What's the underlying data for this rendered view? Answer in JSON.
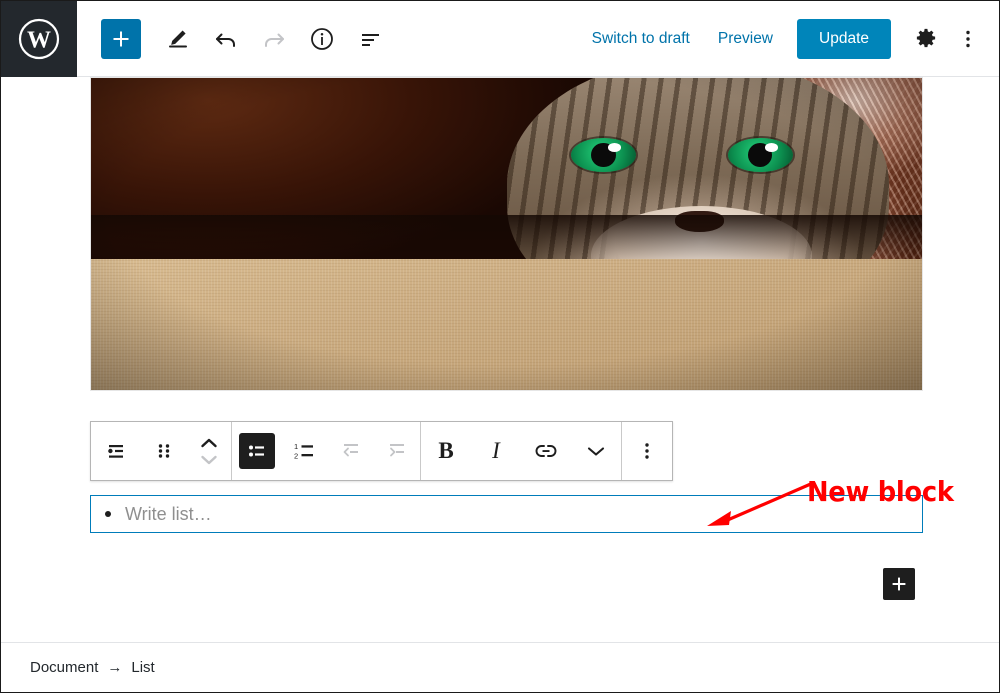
{
  "app": {
    "name": "WordPress Block Editor",
    "logo_icon": "wordpress-logo-icon"
  },
  "topbar": {
    "add_block": {
      "label": "+",
      "icon": "plus-icon",
      "title": "Add block",
      "color": "#0073aa"
    },
    "tools": [
      {
        "name": "edit-tool",
        "icon": "pencil-icon",
        "title": "Tools",
        "enabled": true
      },
      {
        "name": "undo",
        "icon": "undo-arrow-icon",
        "title": "Undo",
        "enabled": true
      },
      {
        "name": "redo",
        "icon": "redo-arrow-icon",
        "title": "Redo",
        "enabled": false
      },
      {
        "name": "details",
        "icon": "info-circle-icon",
        "title": "Details",
        "enabled": true
      },
      {
        "name": "list-view",
        "icon": "block-navigation-icon",
        "title": "Block navigation",
        "enabled": true
      }
    ],
    "switch_to_draft": "Switch to draft",
    "preview": "Preview",
    "update": "Update",
    "settings_icon": "gear-icon",
    "more_menu_icon": "ellipsis-vertical-icon"
  },
  "canvas": {
    "image_block": {
      "alt": "Tabby cat with green eyes peeking out from under a brown blanket on a beige sofa"
    },
    "block_toolbar": {
      "groups": [
        {
          "name": "block-controls",
          "items": [
            {
              "name": "block-type-list",
              "icon": "list-block-icon",
              "title": "List",
              "active": false,
              "enabled": true
            },
            {
              "name": "drag-handle",
              "icon": "drag-dots-icon",
              "title": "Drag",
              "active": false,
              "enabled": true
            },
            {
              "name": "movers",
              "icon": "move-up-down-icon",
              "title": "Move up / Move down",
              "active": false,
              "enabled": true
            }
          ]
        },
        {
          "name": "list-format-controls",
          "items": [
            {
              "name": "unordered-list",
              "icon": "unordered-list-icon",
              "title": "Convert to unordered list",
              "active": true,
              "enabled": true
            },
            {
              "name": "ordered-list",
              "icon": "ordered-list-icon",
              "title": "Convert to ordered list",
              "active": false,
              "enabled": true
            },
            {
              "name": "outdent-list",
              "icon": "outdent-icon",
              "title": "Outdent list item",
              "active": false,
              "enabled": false
            },
            {
              "name": "indent-list",
              "icon": "indent-icon",
              "title": "Indent list item",
              "active": false,
              "enabled": false
            }
          ]
        },
        {
          "name": "text-format-controls",
          "items": [
            {
              "name": "bold",
              "icon": "bold-icon",
              "label": "B",
              "title": "Bold",
              "active": false,
              "enabled": true
            },
            {
              "name": "italic",
              "icon": "italic-icon",
              "label": "I",
              "title": "Italic",
              "active": false,
              "enabled": true
            },
            {
              "name": "link",
              "icon": "link-icon",
              "title": "Link",
              "active": false,
              "enabled": true
            },
            {
              "name": "more-rich-text",
              "icon": "chevron-down-icon",
              "title": "More rich text controls",
              "active": false,
              "enabled": true
            }
          ]
        },
        {
          "name": "block-options",
          "items": [
            {
              "name": "block-options-menu",
              "icon": "ellipsis-vertical-icon",
              "title": "More options",
              "active": false,
              "enabled": true
            }
          ]
        }
      ]
    },
    "list_block": {
      "placeholder": "Write list…",
      "bullet_icon": "bullet-dot-icon",
      "focused": true,
      "focus_color": "#007cba"
    },
    "block_appender": {
      "icon": "plus-icon",
      "title": "Add block",
      "color": "#1e1e1e"
    }
  },
  "annotation": {
    "text": "New block",
    "color": "#ff0000",
    "arrow_icon": "arrow-left-icon"
  },
  "footer": {
    "breadcrumb": [
      "Document",
      "List"
    ],
    "separator": "→"
  }
}
